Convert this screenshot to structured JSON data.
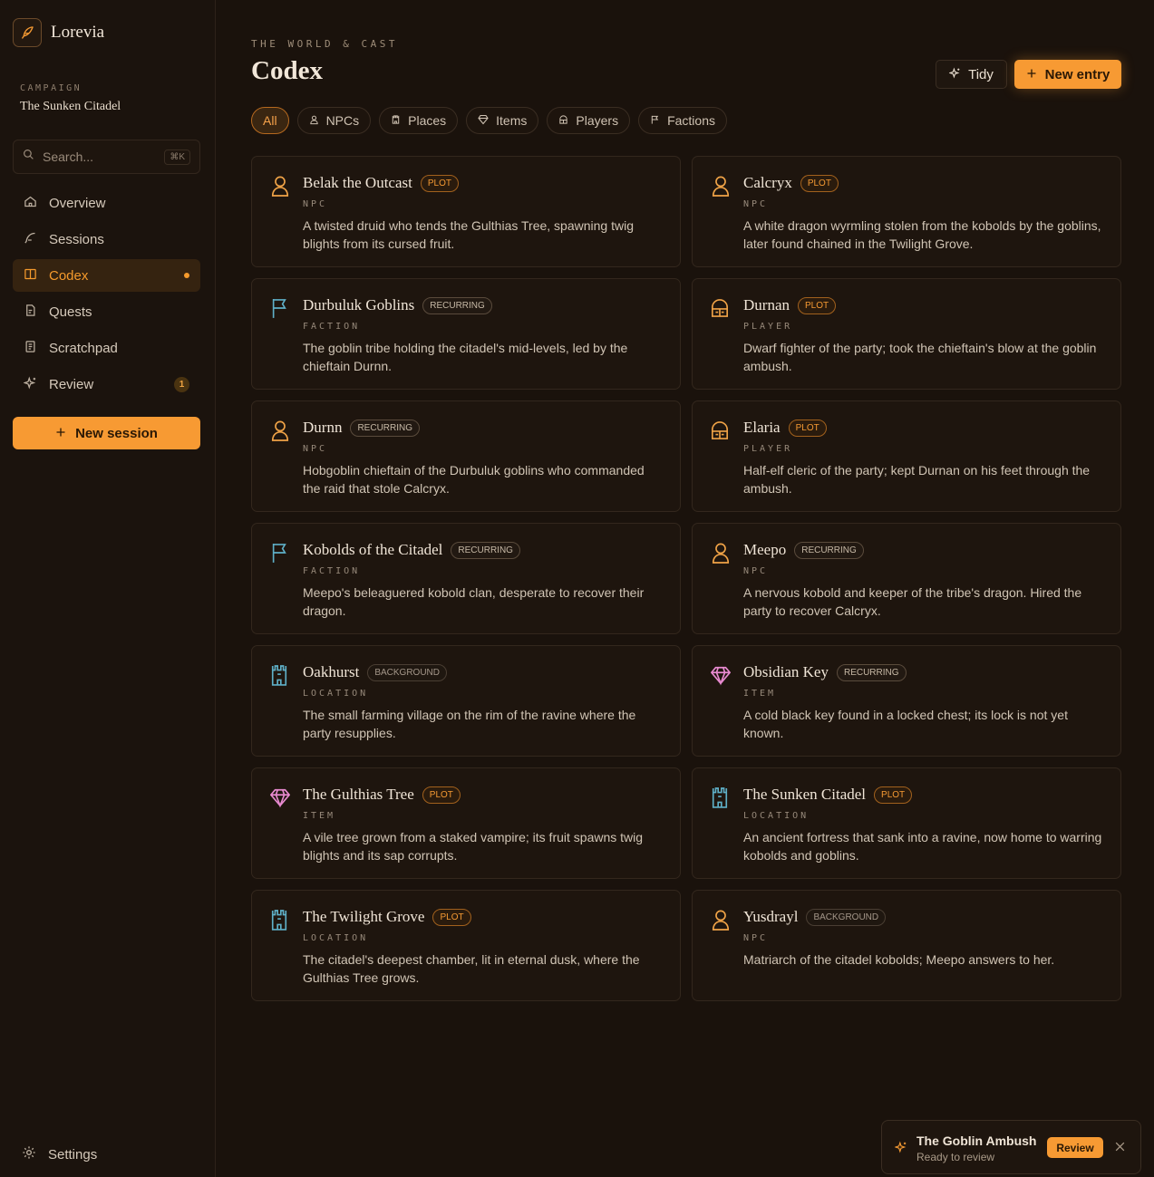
{
  "app": {
    "name": "Lorevia",
    "logo_icon": "quill-icon"
  },
  "campaign": {
    "label": "CAMPAIGN",
    "name": "The Sunken Citadel"
  },
  "search": {
    "placeholder": "Search...",
    "shortcut": "⌘K"
  },
  "nav": [
    {
      "label": "Overview",
      "icon": "home-icon"
    },
    {
      "label": "Sessions",
      "icon": "feather-icon"
    },
    {
      "label": "Codex",
      "icon": "book-icon",
      "active": true
    },
    {
      "label": "Quests",
      "icon": "scroll-icon"
    },
    {
      "label": "Scratchpad",
      "icon": "notepad-icon"
    },
    {
      "label": "Review",
      "icon": "sparkle-icon",
      "count": "1"
    }
  ],
  "new_session_label": "New session",
  "settings_label": "Settings",
  "header": {
    "eyebrow": "THE WORLD & CAST",
    "title": "Codex",
    "tidy_label": "Tidy",
    "new_entry_label": "New entry"
  },
  "filters": [
    {
      "label": "All",
      "active": true
    },
    {
      "label": "NPCs",
      "icon": "person-icon"
    },
    {
      "label": "Places",
      "icon": "tower-icon"
    },
    {
      "label": "Items",
      "icon": "gem-icon"
    },
    {
      "label": "Players",
      "icon": "helmet-icon"
    },
    {
      "label": "Factions",
      "icon": "flag-icon"
    }
  ],
  "entries": [
    {
      "name": "Belak the Outcast",
      "badge": "PLOT",
      "kind": "NPC",
      "icon": "person",
      "desc": "A twisted druid who tends the Gulthias Tree, spawning twig blights from its cursed fruit."
    },
    {
      "name": "Calcryx",
      "badge": "PLOT",
      "kind": "NPC",
      "icon": "person",
      "desc": "A white dragon wyrmling stolen from the kobolds by the goblins, later found chained in the Twilight Grove."
    },
    {
      "name": "Durbuluk Goblins",
      "badge": "RECURRING",
      "kind": "FACTION",
      "icon": "flag",
      "desc": "The goblin tribe holding the citadel's mid-levels, led by the chieftain Durnn."
    },
    {
      "name": "Durnan",
      "badge": "PLOT",
      "kind": "PLAYER",
      "icon": "helmet",
      "desc": "Dwarf fighter of the party; took the chieftain's blow at the goblin ambush."
    },
    {
      "name": "Durnn",
      "badge": "RECURRING",
      "kind": "NPC",
      "icon": "person",
      "desc": "Hobgoblin chieftain of the Durbuluk goblins who commanded the raid that stole Calcryx."
    },
    {
      "name": "Elaria",
      "badge": "PLOT",
      "kind": "PLAYER",
      "icon": "helmet",
      "desc": "Half-elf cleric of the party; kept Durnan on his feet through the ambush."
    },
    {
      "name": "Kobolds of the Citadel",
      "badge": "RECURRING",
      "kind": "FACTION",
      "icon": "flag",
      "desc": "Meepo's beleaguered kobold clan, desperate to recover their dragon."
    },
    {
      "name": "Meepo",
      "badge": "RECURRING",
      "kind": "NPC",
      "icon": "person",
      "desc": "A nervous kobold and keeper of the tribe's dragon. Hired the party to recover Calcryx."
    },
    {
      "name": "Oakhurst",
      "badge": "BACKGROUND",
      "kind": "LOCATION",
      "icon": "tower",
      "desc": "The small farming village on the rim of the ravine where the party resupplies."
    },
    {
      "name": "Obsidian Key",
      "badge": "RECURRING",
      "kind": "ITEM",
      "icon": "gem",
      "desc": "A cold black key found in a locked chest; its lock is not yet known."
    },
    {
      "name": "The Gulthias Tree",
      "badge": "PLOT",
      "kind": "ITEM",
      "icon": "gem",
      "desc": "A vile tree grown from a staked vampire; its fruit spawns twig blights and its sap corrupts."
    },
    {
      "name": "The Sunken Citadel",
      "badge": "PLOT",
      "kind": "LOCATION",
      "icon": "tower",
      "desc": "An ancient fortress that sank into a ravine, now home to warring kobolds and goblins."
    },
    {
      "name": "The Twilight Grove",
      "badge": "PLOT",
      "kind": "LOCATION",
      "icon": "tower",
      "desc": "The citadel's deepest chamber, lit in eternal dusk, where the Gulthias Tree grows."
    },
    {
      "name": "Yusdrayl",
      "badge": "BACKGROUND",
      "kind": "NPC",
      "icon": "person",
      "desc": "Matriarch of the citadel kobolds; Meepo answers to her."
    }
  ],
  "toast": {
    "title": "The Goblin Ambush",
    "subtitle": "Ready to review",
    "action": "Review"
  },
  "colors": {
    "accent": "#f79a33",
    "background": "#1a120c",
    "person": "#f0a347",
    "flag": "#5fb0c8",
    "tower": "#5fb0c8",
    "gem": "#e88ad0",
    "helmet": "#f0a347"
  }
}
